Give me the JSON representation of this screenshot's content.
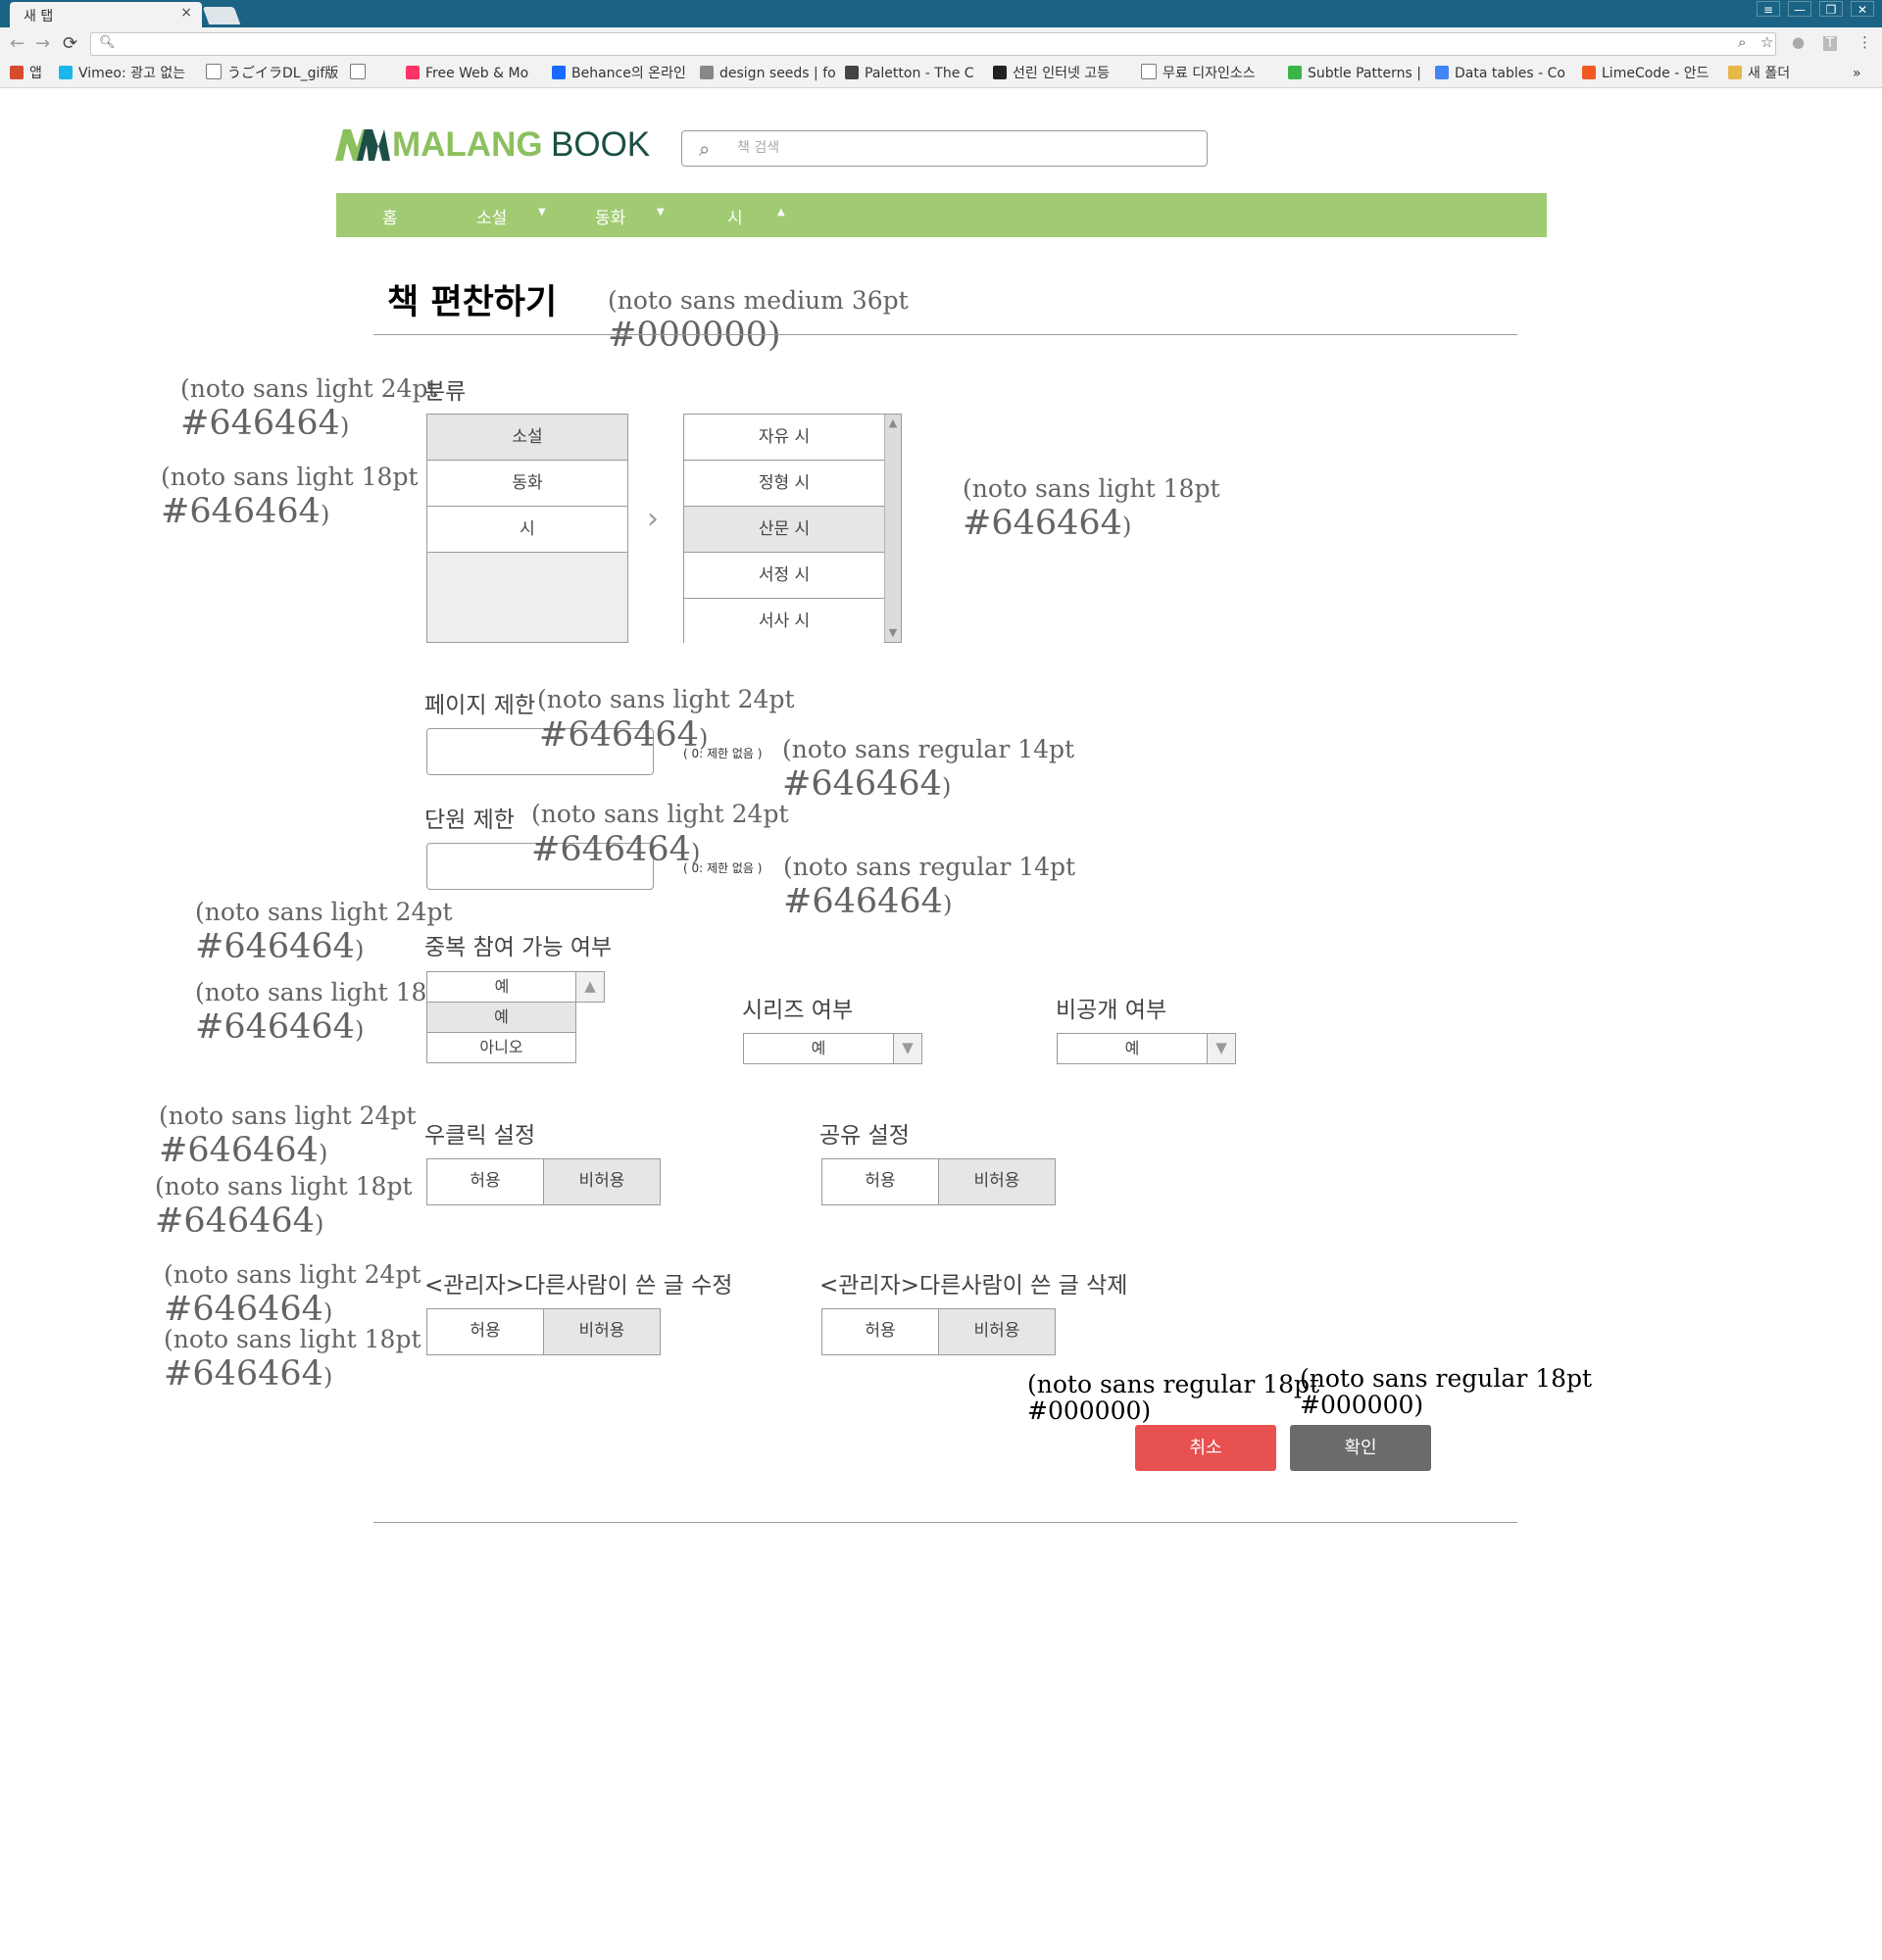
{
  "browser": {
    "tab_title": "새 탭",
    "tab_close": "×",
    "window_controls": [
      "≡",
      "—",
      "❐",
      "✕"
    ],
    "nav": {
      "back": "←",
      "forward": "→",
      "reload": "⟳"
    },
    "url_icon": "search-icon",
    "toolbar_icons": [
      "zoom-icon",
      "star-icon",
      "extension-icon",
      "t-icon",
      "menu-icon"
    ],
    "bookmarks": [
      {
        "label": "앱",
        "icon": "apps-icon",
        "color": "#d64a2f"
      },
      {
        "label": "Vimeo: 광고 없는",
        "icon": "vimeo-icon",
        "color": "#1ab7ea"
      },
      {
        "label": "うごイラDL_gif版",
        "icon": "page-icon",
        "color": "#ffffff"
      },
      {
        "label": "",
        "icon": "page-icon",
        "color": "#ffffff"
      },
      {
        "label": "Free Web & Mo",
        "icon": "invision-icon",
        "color": "#ff3366"
      },
      {
        "label": "Behance의 온라인",
        "icon": "behance-icon",
        "color": "#1769ff"
      },
      {
        "label": "design seeds | fo",
        "icon": "design-seeds-icon",
        "color": "#888888"
      },
      {
        "label": "Paletton - The C",
        "icon": "paletton-icon",
        "color": "#444444"
      },
      {
        "label": "선린 인터넷 고등",
        "icon": "sunrin-icon",
        "color": "#222222"
      },
      {
        "label": "무료 디자인소스",
        "icon": "page-icon",
        "color": "#ffffff"
      },
      {
        "label": "Subtle Patterns |",
        "icon": "subtle-patterns-icon",
        "color": "#3bb54a"
      },
      {
        "label": "Data tables - Co",
        "icon": "google-icon",
        "color": "#4285f4"
      },
      {
        "label": "LimeCode - 안드",
        "icon": "limecode-icon",
        "color": "#f15a24"
      },
      {
        "label": "새 폴더",
        "icon": "folder-icon",
        "color": "#e6b84a"
      }
    ],
    "overflow": "»"
  },
  "header": {
    "logo_word1": "MALANG",
    "logo_word2": "BOOK",
    "search_placeholder": "책 검색",
    "nav": [
      {
        "label": "홈",
        "arrow": ""
      },
      {
        "label": "소설",
        "arrow": "▼"
      },
      {
        "label": "동화",
        "arrow": "▼"
      },
      {
        "label": "시",
        "arrow": "▲"
      }
    ]
  },
  "title": {
    "text": "책 편찬하기",
    "note_line1": "(noto sans medium 36pt",
    "note_line2": "#000000)"
  },
  "category": {
    "label": "분류",
    "primary": [
      "소설",
      "동화",
      "시"
    ],
    "primary_selected": 0,
    "secondary": [
      "자유 시",
      "정형 시",
      "산문 시",
      "서정 시",
      "서사 시"
    ],
    "secondary_selected": 2,
    "scroll_up": "▲",
    "scroll_down": "▼",
    "chevron": "›"
  },
  "limits": {
    "page_label": "페이지 제한",
    "page_hint": "( 0: 제한 없음 )",
    "unit_label": "단원 제한",
    "unit_hint": "( 0: 제한 없음 )"
  },
  "options": {
    "duplicate_label": "중복 참여 가능 여부",
    "duplicate_value": "예",
    "duplicate_options": [
      "예",
      "아니오"
    ],
    "series_label": "시리즈 여부",
    "series_value": "예",
    "private_label": "비공개 여부",
    "private_value": "예",
    "arrow_down": "▼",
    "arrow_up": "▲"
  },
  "toggles": {
    "right_click_label": "우클릭 설정",
    "share_label": "공유 설정",
    "admin_edit_label": "<관리자>다른사람이 쓴 글 수정",
    "admin_delete_label": "<관리자>다른사람이 쓴 글 삭제",
    "allow": "허용",
    "deny": "비허용"
  },
  "actions": {
    "cancel": "취소",
    "confirm": "확인",
    "cancel_color": "#e85151",
    "confirm_color": "#6b6b6b"
  },
  "notes": {
    "light24": "(noto sans light 24pt",
    "light18": "(noto sans light 18pt",
    "regular14": "(noto sans regular 14pt",
    "regular18": "(noto sans regular 18pt",
    "hex_gray": "#646464",
    "hex_black": "#000000",
    "close_paren": ")"
  },
  "colors": {
    "brand_green": "#a1cb73",
    "logo_green": "#8cc05e",
    "text_gray": "#646464",
    "chrome_blue": "#1a6384"
  }
}
